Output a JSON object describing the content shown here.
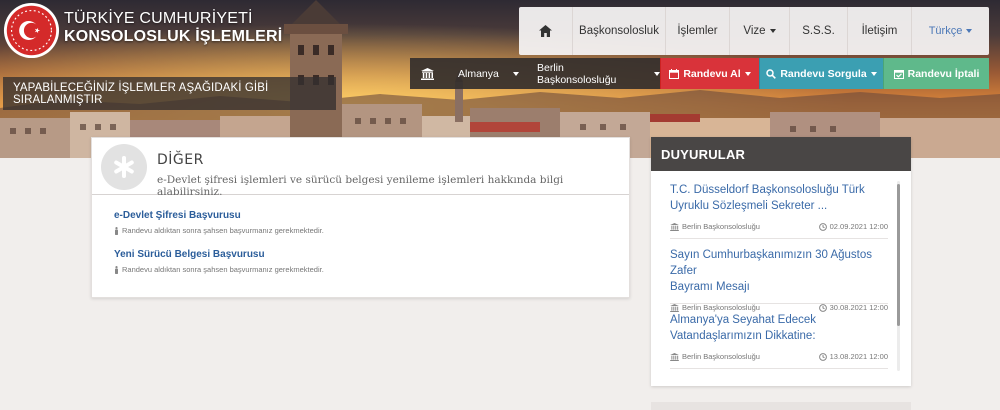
{
  "header": {
    "brand_line1": "TÜRKİYE CUMHURİYETİ",
    "brand_line2": "KONSOLOSLUK İŞLEMLERİ",
    "banner": "YAPABİLECEĞİNİZ İŞLEMLER AŞAĞIDAKİ GİBİ SIRALANMIŞTIR"
  },
  "topnav": {
    "home_icon": "home-icon",
    "items": [
      "Başkonsolosluk",
      "İşlemler",
      "Vize",
      "S.S.S.",
      "İletişim"
    ],
    "language": "Türkçe"
  },
  "subnav": {
    "country": "Almanya",
    "mission": "Berlin Başkonsolosluğu",
    "appointment": "Randevu Al",
    "query": "Randevu Sorgula",
    "cancel": "Randevu İptali"
  },
  "card": {
    "title": "DİĞER",
    "description": "e-Devlet şifresi işlemleri ve sürücü belgesi yenileme işlemleri hakkında bilgi alabilirsiniz.",
    "services": [
      {
        "label": "e-Devlet Şifresi Başvurusu",
        "note": "Randevu aldıktan sonra şahsen başvurmanız gerekmektedir."
      },
      {
        "label": "Yeni Sürücü Belgesi Başvurusu",
        "note": "Randevu aldıktan sonra şahsen başvurmanız gerekmektedir."
      }
    ]
  },
  "news": {
    "title": "DUYURULAR",
    "items": [
      {
        "line1": "T.C. Düsseldorf Başkonsolosluğu Türk",
        "line2": "Uyruklu Sözleşmeli Sekreter ...",
        "source": "Berlin Başkonsolosluğu",
        "date": "02.09.2021 12:00"
      },
      {
        "line1": "Sayın Cumhurbaşkanımızın 30 Ağustos Zafer",
        "line2": "Bayramı Mesajı",
        "source": "Berlin Başkonsolosluğu",
        "date": "30.08.2021 12:00"
      },
      {
        "line1": "Almanya'ya Seyahat Edecek",
        "line2": "Vatandaşlarımızın Dikkatine:",
        "source": "Berlin Başkonsolosluğu",
        "date": "13.08.2021 12:00"
      }
    ]
  },
  "colors": {
    "appointment": "#d9333a",
    "query": "#3b9fb2",
    "cancel": "#5fb98b",
    "news_header": "#494645",
    "link": "#2b5d9a"
  }
}
